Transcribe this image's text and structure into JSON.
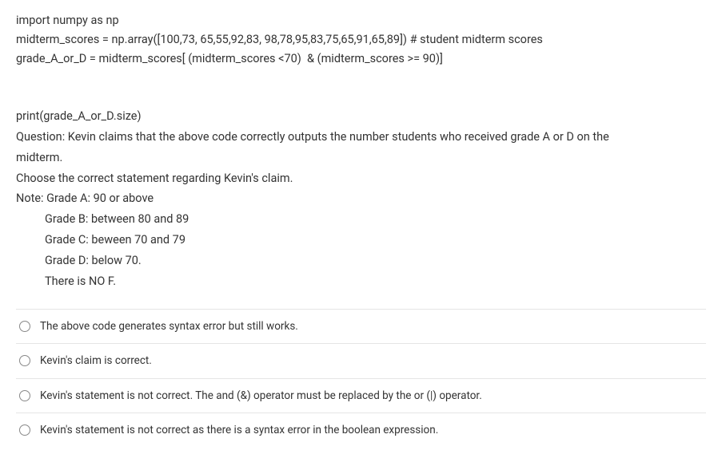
{
  "code": {
    "line1": "import numpy as np",
    "line2": "midterm_scores = np.array([100,73, 65,55,92,83, 98,78,95,83,75,65,91,65,89]) # student midterm scores",
    "line3": "grade_A_or_D = midterm_scores[ (midterm_scores <70)  & (midterm_scores >= 90)]",
    "line4": "print(grade_A_or_D.size)"
  },
  "question": {
    "prompt_line1": "Question: Kevin claims that the above code correctly outputs the number students who received grade A or D on the",
    "prompt_line2": "midterm.",
    "choose": "Choose the correct statement regarding Kevin's claim.",
    "note_label": "Note: Grade A: 90 or above",
    "grade_b": "Grade B: between 80 and 89",
    "grade_c": "Grade C: beween 70 and 79",
    "grade_d": "Grade D: below 70.",
    "no_f": "There is NO F."
  },
  "options": [
    "The above code generates syntax error but still works.",
    "Kevin's claim is correct.",
    "Kevin's statement is not correct. The and (&) operator must be replaced by the or (|) operator.",
    "Kevin's statement is not correct as there is a syntax error in the boolean expression."
  ]
}
